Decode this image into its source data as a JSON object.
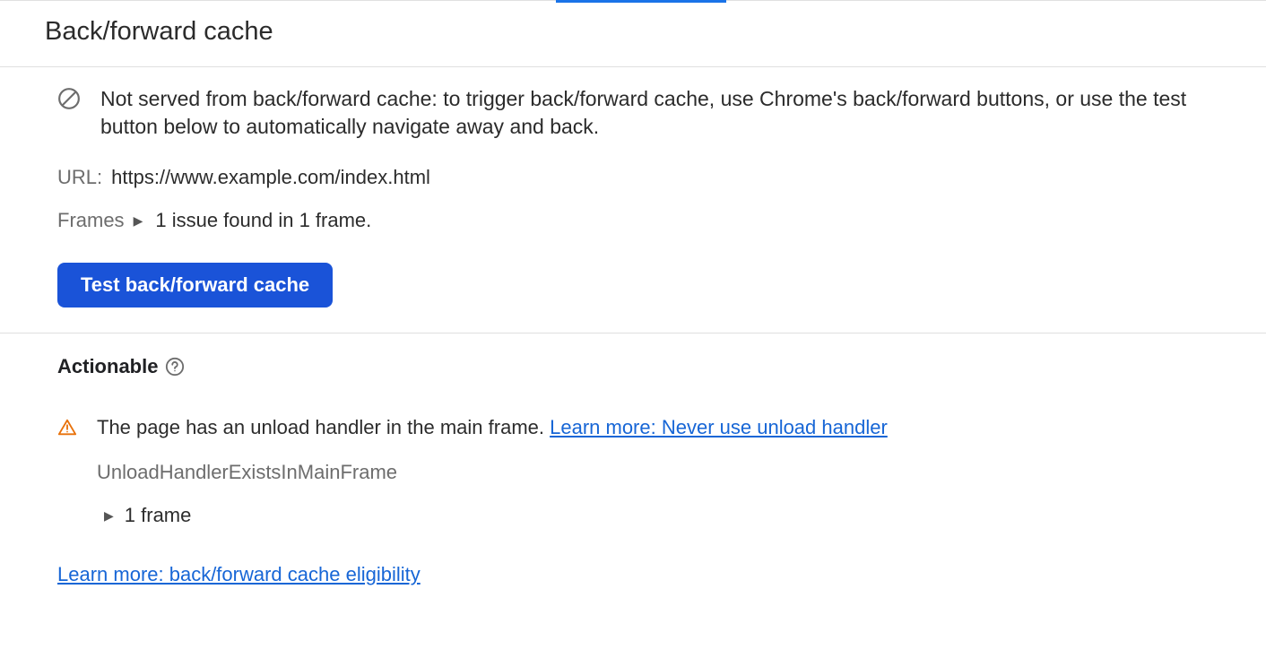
{
  "header": {
    "title": "Back/forward cache"
  },
  "status": {
    "message": "Not served from back/forward cache: to trigger back/forward cache, use Chrome's back/forward buttons, or use the test button below to automatically navigate away and back."
  },
  "url": {
    "label": "URL:",
    "value": "https://www.example.com/index.html"
  },
  "frames": {
    "label": "Frames",
    "summary": "1 issue found in 1 frame."
  },
  "button": {
    "test_label": "Test back/forward cache"
  },
  "actionable": {
    "title": "Actionable",
    "issue_text": "The page has an unload handler in the main frame. ",
    "issue_link": "Learn more: Never use unload handler",
    "issue_code": "UnloadHandlerExistsInMainFrame",
    "frame_count": "1 frame"
  },
  "footer": {
    "learn_more": "Learn more: back/forward cache eligibility"
  }
}
